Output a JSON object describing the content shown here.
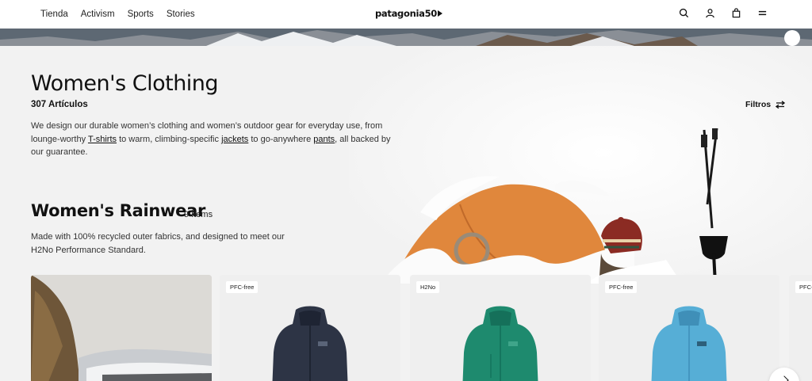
{
  "header": {
    "nav": [
      "Tienda",
      "Activism",
      "Sports",
      "Stories"
    ],
    "logo": "patagonia50",
    "icons": [
      "search-icon",
      "user-icon",
      "bag-icon",
      "menu-icon"
    ]
  },
  "page": {
    "title": "Women's Clothing",
    "count": "307 Artículos",
    "filters_label": "Filtros",
    "description": {
      "part1": "We design our durable women’s clothing and women’s outdoor gear for everyday use, from lounge-worthy ",
      "link1": "T-shirts",
      "part2": " to warm, climbing-specific ",
      "link2": "jackets",
      "part3": " to go-anywhere ",
      "link3": "pants",
      "part4": ", all backed by our guarantee."
    }
  },
  "section": {
    "title": "Women's Rainwear",
    "count": "9 Ítems",
    "description": "Made with 100% recycled outer fabrics, and designed to meet our H2No Performance Standard."
  },
  "cards": [
    {
      "badge": "PFC-free",
      "color": "#2d3445"
    },
    {
      "badge": "H2No",
      "color": "#1e8a6e"
    },
    {
      "badge": "PFC-free",
      "color": "#56aed6"
    },
    {
      "badge": "PFC-f"
    }
  ],
  "colors": {
    "tent": "#e0873c",
    "background": "#f2f2f2"
  }
}
